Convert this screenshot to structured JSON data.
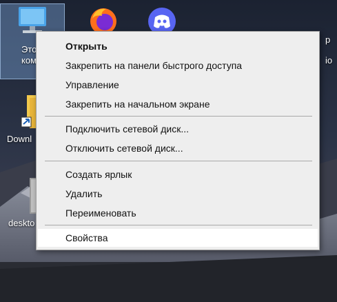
{
  "desktop": {
    "icons": [
      {
        "name": "this-pc",
        "label": "Этот компьютер",
        "label_visible": "Это\nкомпь"
      },
      {
        "name": "firefox",
        "label": ""
      },
      {
        "name": "discord",
        "label": ""
      },
      {
        "name": "downloads",
        "label": "Downl"
      },
      {
        "name": "desktop-shortcut",
        "label": "deskto"
      },
      {
        "name": "partial-right",
        "label": "p"
      },
      {
        "name": "partial-right2",
        "label": "io"
      }
    ]
  },
  "context_menu": {
    "items": [
      {
        "label": "Открыть",
        "bold": true
      },
      {
        "label": "Закрепить на панели быстрого доступа"
      },
      {
        "label": "Управление"
      },
      {
        "label": "Закрепить на начальном экране"
      },
      {
        "separator": true
      },
      {
        "label": "Подключить сетевой диск..."
      },
      {
        "label": "Отключить сетевой диск..."
      },
      {
        "separator": true
      },
      {
        "label": "Создать ярлык"
      },
      {
        "label": "Удалить"
      },
      {
        "label": "Переименовать"
      },
      {
        "separator": true
      },
      {
        "label": "Свойства",
        "hover": true
      }
    ]
  },
  "colors": {
    "menu_bg": "#eeeeee",
    "menu_hover": "#ffffff",
    "selection": "#7aa0d2",
    "discord": "#5865f2"
  }
}
